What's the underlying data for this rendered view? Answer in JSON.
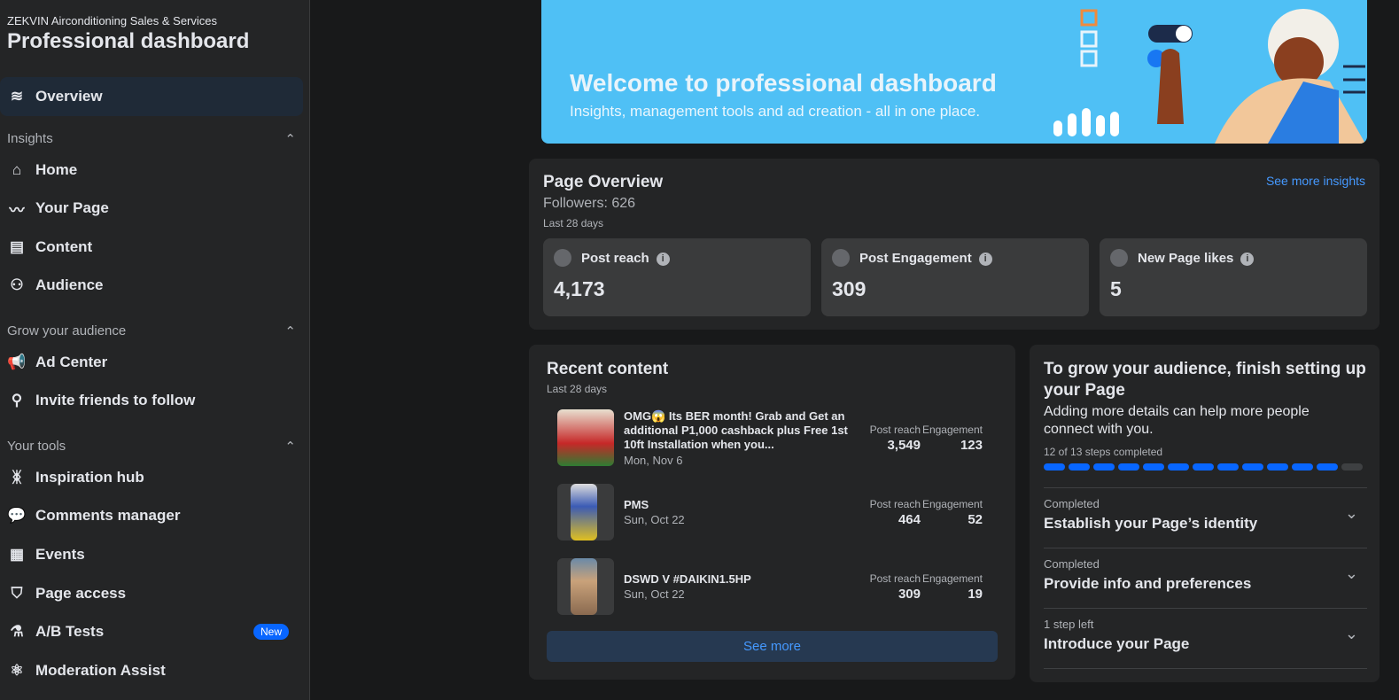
{
  "sidebar": {
    "subtitle": "ZEKVIN Airconditioning Sales & Services",
    "title": "Professional dashboard",
    "overview": "Overview",
    "sections": [
      {
        "label": "Insights",
        "items": [
          "Home",
          "Your Page",
          "Content",
          "Audience"
        ]
      },
      {
        "label": "Grow your audience",
        "items": [
          "Ad Center",
          "Invite friends to follow"
        ]
      },
      {
        "label": "Your tools",
        "items": [
          "Inspiration hub",
          "Comments manager",
          "Events",
          "Page access",
          "A/B Tests",
          "Moderation Assist"
        ]
      }
    ],
    "new_badge": "New"
  },
  "banner": {
    "title": "Welcome to professional dashboard",
    "subtitle": "Insights, management tools and ad creation - all in one place."
  },
  "overview": {
    "title": "Page Overview",
    "followers": "Followers: 626",
    "period": "Last 28 days",
    "link": "See more insights",
    "metrics": [
      {
        "label": "Post reach",
        "value": "4,173"
      },
      {
        "label": "Post Engagement",
        "value": "309"
      },
      {
        "label": "New Page likes",
        "value": "5"
      }
    ]
  },
  "recent": {
    "title": "Recent content",
    "period": "Last 28 days",
    "reach_label": "Post reach",
    "eng_label": "Engagement",
    "see_more": "See more",
    "posts": [
      {
        "title": "OMG😱 Its BER month! Grab and Get an additional P1,000 cashback plus Free 1st 10ft Installation when you...",
        "date": "Mon, Nov 6",
        "reach": "3,549",
        "engagement": "123"
      },
      {
        "title": "PMS",
        "date": "Sun, Oct 22",
        "reach": "464",
        "engagement": "52"
      },
      {
        "title": "DSWD V #DAIKIN1.5HP",
        "date": "Sun, Oct 22",
        "reach": "309",
        "engagement": "19"
      }
    ]
  },
  "setup": {
    "title": "To grow your audience, finish setting up your Page",
    "desc": "Adding more details can help more people connect with you.",
    "progress_text": "12 of 13 steps completed",
    "completed": 12,
    "total": 13,
    "steps": [
      {
        "status": "Completed",
        "label": "Establish your Page’s identity"
      },
      {
        "status": "Completed",
        "label": "Provide info and preferences"
      },
      {
        "status": "1 step left",
        "label": "Introduce your Page"
      }
    ]
  }
}
